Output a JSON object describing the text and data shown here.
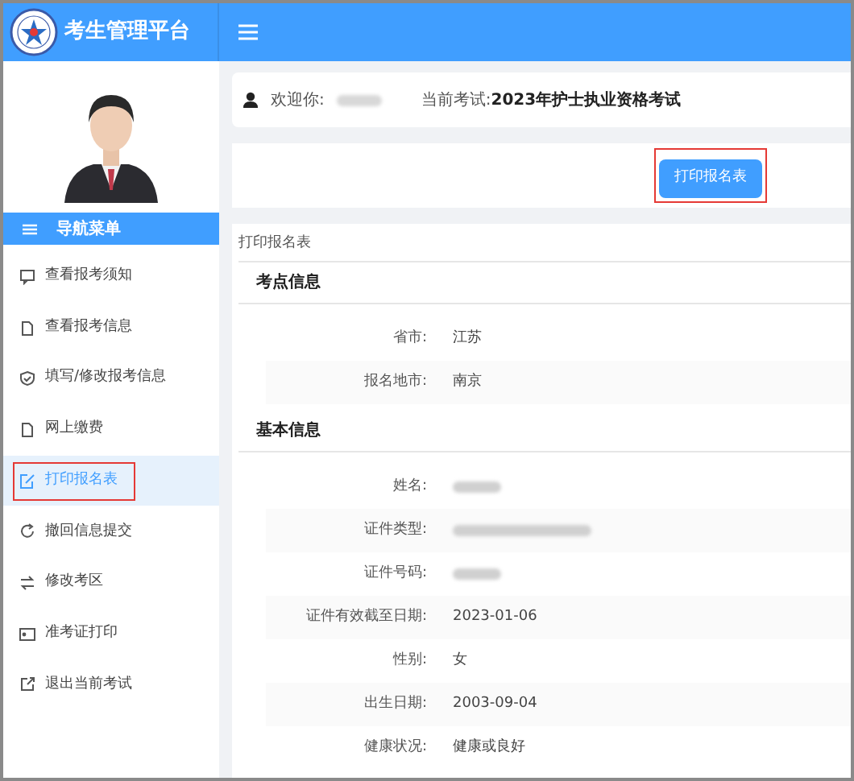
{
  "header": {
    "title": "考生管理平台"
  },
  "nav": {
    "title": "导航菜单",
    "items": [
      {
        "label": "查看报考须知",
        "selected": false,
        "outlined": false
      },
      {
        "label": "查看报考信息",
        "selected": false,
        "outlined": false
      },
      {
        "label": "填写/修改报考信息",
        "selected": false,
        "outlined": false
      },
      {
        "label": "网上缴费",
        "selected": false,
        "outlined": false
      },
      {
        "label": "打印报名表",
        "selected": true,
        "outlined": true
      },
      {
        "label": "撤回信息提交",
        "selected": false,
        "outlined": false
      },
      {
        "label": "修改考区",
        "selected": false,
        "outlined": false
      },
      {
        "label": "准考证打印",
        "selected": false,
        "outlined": false
      },
      {
        "label": "退出当前考试",
        "selected": false,
        "outlined": false
      }
    ]
  },
  "welcome": {
    "label": "欢迎你:",
    "exam_label": "当前考试:",
    "exam": "2023年护士执业资格考试"
  },
  "print_button": {
    "label": "打印报名表",
    "outlined": true
  },
  "form": {
    "title": "打印报名表",
    "sections": [
      {
        "title": "考点信息",
        "rows": [
          {
            "label": "省市:",
            "value": "江苏"
          },
          {
            "label": "报名地市:",
            "value": "南京"
          }
        ]
      },
      {
        "title": "基本信息",
        "rows": [
          {
            "label": "姓名:",
            "redacted": true
          },
          {
            "label": "证件类型:",
            "redacted": true
          },
          {
            "label": "证件号码:",
            "redacted": true
          },
          {
            "label": "证件有效截至日期:",
            "value": "2023-01-06"
          },
          {
            "label": "性别:",
            "value": "女"
          },
          {
            "label": "出生日期:",
            "value": "2003-09-04"
          },
          {
            "label": "健康状况:",
            "value": "健康或良好"
          }
        ]
      }
    ]
  }
}
